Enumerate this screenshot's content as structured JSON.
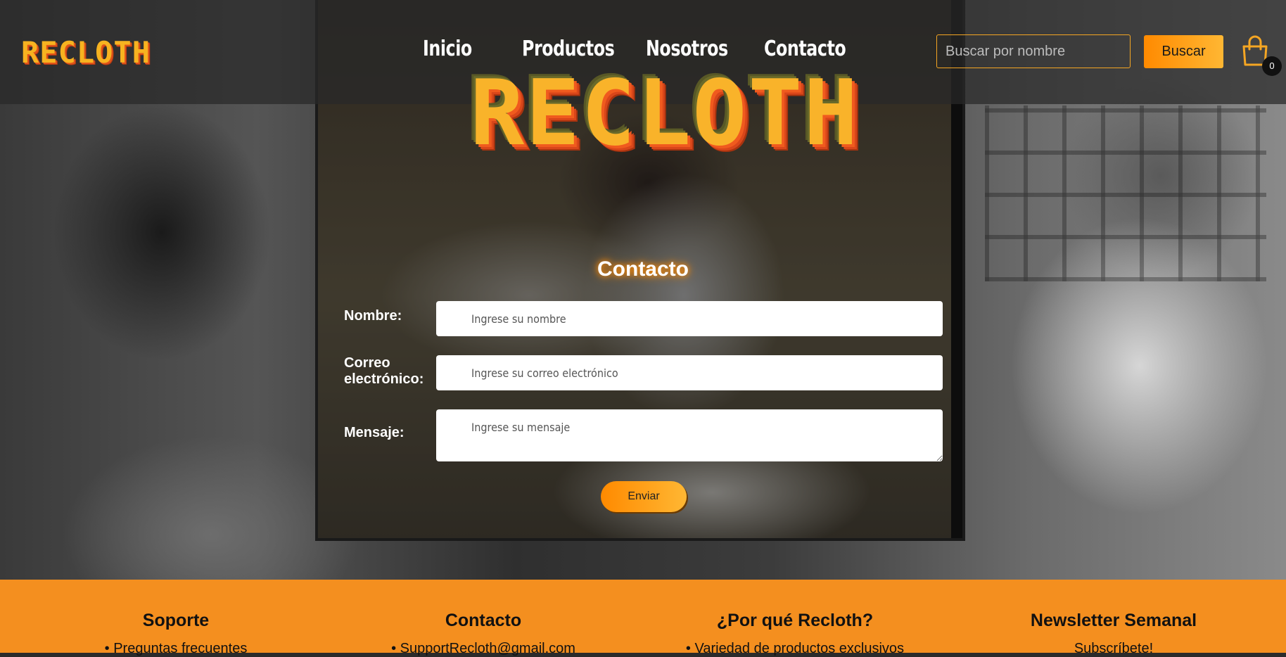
{
  "brand": {
    "logo": "RECLOTH"
  },
  "nav": {
    "items": [
      {
        "label": "Inicio"
      },
      {
        "label": "Productos"
      },
      {
        "label": "Nosotros"
      },
      {
        "label": "Contacto"
      }
    ]
  },
  "search": {
    "placeholder": "Buscar por nombre",
    "value": "",
    "button_label": "Buscar"
  },
  "cart": {
    "icon": "shopping-bag-icon",
    "count": "0"
  },
  "hero": {
    "logo": "RECLOTH"
  },
  "contact_form": {
    "title": "Contacto",
    "name_label": "Nombre:",
    "name_placeholder": "Ingrese su nombre",
    "email_label": "Correo electrónico:",
    "email_placeholder": "Ingrese su correo electrónico",
    "message_label": "Mensaje:",
    "message_placeholder": "Ingrese su mensaje",
    "submit_label": "Enviar"
  },
  "footer": {
    "columns": [
      {
        "title": "Soporte",
        "first_item": "• Preguntas frecuentes"
      },
      {
        "title": "Contacto",
        "first_item": "• SupportRecloth@gmail.com"
      },
      {
        "title": "¿Por qué Recloth?",
        "first_item": "• Variedad de productos exclusivos"
      },
      {
        "title": "Newsletter Semanal",
        "first_item": "Subscríbete!"
      }
    ]
  },
  "colors": {
    "accent": "#f48f1f",
    "button_gradient_start": "#ff8a00",
    "button_gradient_end": "#ffb733",
    "logo_yellow": "#f9b32a",
    "logo_shadow": "#f05a1e"
  }
}
